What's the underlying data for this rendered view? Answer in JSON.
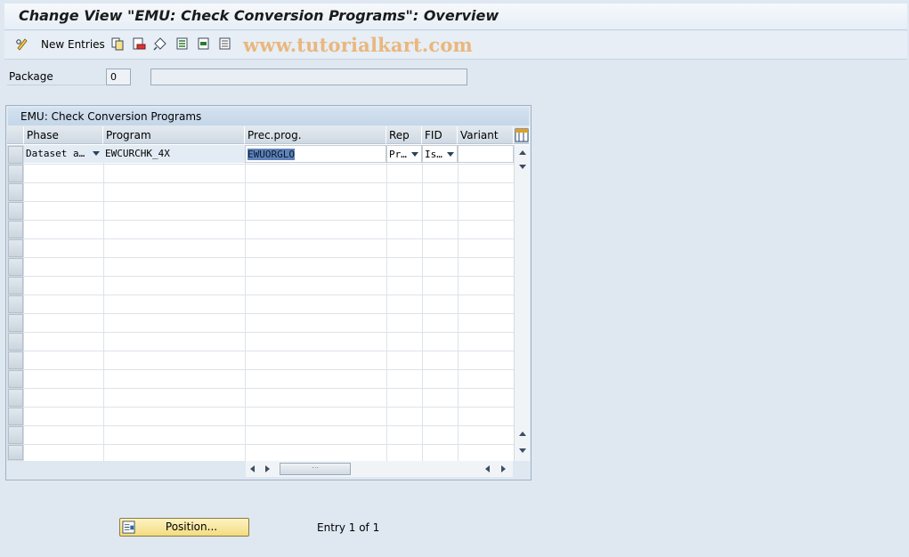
{
  "window": {
    "title": "Change View \"EMU: Check Conversion Programs\": Overview"
  },
  "toolbar": {
    "new_entries_label": "New Entries",
    "watermark": "www.tutorialkart.com",
    "icons": [
      "glasses-pencil-icon",
      "copy-icon",
      "delete-icon",
      "undo-icon",
      "select-all-icon",
      "select-block-icon",
      "deselect-all-icon"
    ]
  },
  "package": {
    "label": "Package",
    "value": "0",
    "description": ""
  },
  "table": {
    "title": "EMU: Check Conversion Programs",
    "columns": [
      "Phase",
      "Program",
      "Prec.prog.",
      "Rep",
      "FID",
      "Variant"
    ],
    "rows": [
      {
        "phase": "Dataset a…",
        "program": "EWCURCHK_4X",
        "prec_prog": "EWUORGLO",
        "rep": "Pr…",
        "fid": "Is…",
        "variant": ""
      }
    ]
  },
  "footer": {
    "position_button": "Position...",
    "entry_info": "Entry 1 of 1"
  },
  "colors": {
    "background": "#dfe8f1",
    "position_button": "#f3dc80",
    "selection_highlight": "#5f83b9"
  }
}
